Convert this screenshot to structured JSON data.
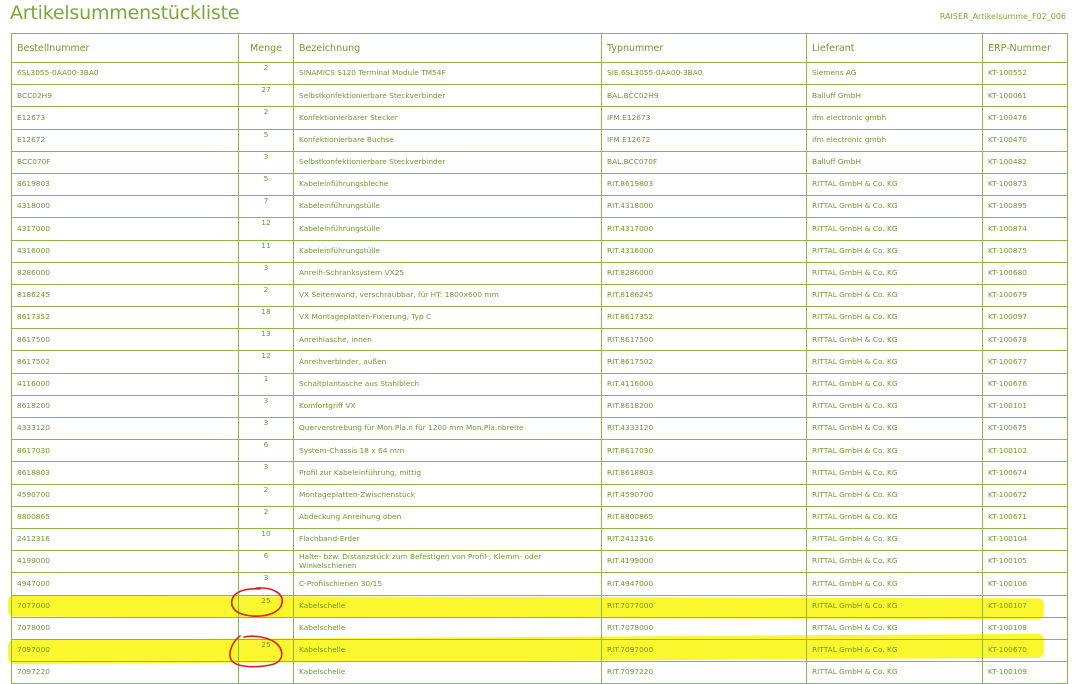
{
  "page": {
    "title": "Artikelsummenstückliste",
    "doc_id": "RAISER_Artikelsumme_F02_006"
  },
  "table": {
    "headers": [
      "Bestellnummer",
      "Menge",
      "Bezeichnung",
      "Typnummer",
      "Lieferant",
      "ERP-Nummer"
    ],
    "rows": [
      [
        "6SL3055-0AA00-3BA0",
        "2",
        "SINAMICS S120 Terminal Module TM54F",
        "SIE.6SL3055-0AA00-3BA0",
        "Siemens AG",
        "KT-100552"
      ],
      [
        "BCC02H9",
        "27",
        "Selbstkonfektionierbare Steckverbinder",
        "BAL.BCC02H9",
        "Balluff GmbH",
        "KT-100061"
      ],
      [
        "E12673",
        "2",
        "Konfektionierbarer Stecker",
        "IFM.E12673",
        "ifm electronic gmbh",
        "KT-100476"
      ],
      [
        "E12672",
        "5",
        "Konfektionierbare Buchse",
        "IFM.E12672",
        "ifm electronic gmbh",
        "KT-100470"
      ],
      [
        "BCC070F",
        "3",
        "Selbstkonfektionierbare Steckverbinder",
        "BAL.BCC070F",
        "Balluff GmbH",
        "KT-100482"
      ],
      [
        "8619803",
        "5",
        "Kabeleinführungsbleche",
        "RIT.8619803",
        "RITTAL GmbH & Co. KG",
        "KT-100873"
      ],
      [
        "4318000",
        "7",
        "Kabeleinführungstülle",
        "RIT.4318000",
        "RITTAL GmbH & Co. KG",
        "KT-100895"
      ],
      [
        "4317000",
        "12",
        "Kabeleinführungstülle",
        "RIT.4317000",
        "RITTAL GmbH & Co. KG",
        "KT-100874"
      ],
      [
        "4316000",
        "11",
        "Kabeleinführungstülle",
        "RIT.4316000",
        "RITTAL GmbH & Co. KG",
        "KT-100875"
      ],
      [
        "8286000",
        "3",
        "Anreih-Schranksystem VX25",
        "RIT.8286000",
        "RITTAL GmbH & Co. KG",
        "KT-100680"
      ],
      [
        "8186245",
        "2",
        "VX Seitenwand, verschraubbar, für HT: 1800x600 mm",
        "RIT.8186245",
        "RITTAL GmbH & Co. KG",
        "KT-100679"
      ],
      [
        "8617352",
        "18",
        "VX Montageplatten-Fixierung, Typ C",
        "RIT.8617352",
        "RITTAL GmbH & Co. KG",
        "KT-100097"
      ],
      [
        "8617500",
        "13",
        "Anreihlasche, innen",
        "RIT.8617500",
        "RITTAL GmbH & Co. KG",
        "KT-100678"
      ],
      [
        "8617502",
        "12",
        "Anreihverbinder, außen",
        "RIT.8617502",
        "RITTAL GmbH & Co. KG",
        "KT-100677"
      ],
      [
        "4116000",
        "1",
        "Schaltplantasche aus Stahlblech",
        "RIT.4116000",
        "RITTAL GmbH & Co. KG",
        "KT-100676"
      ],
      [
        "8618200",
        "3",
        "Komfortgriff VX",
        "RIT.8618200",
        "RITTAL GmbH & Co. KG",
        "KT-100101"
      ],
      [
        "4333120",
        "3",
        "Querverstrebung für Mon.Pla.n für 1200 mm Mon.Pla.nbreite",
        "RIT.4333120",
        "RITTAL GmbH & Co. KG",
        "KT-100675"
      ],
      [
        "8617030",
        "6",
        "System-Chassis 18 x 64 mm",
        "RIT.8617030",
        "RITTAL GmbH & Co. KG",
        "KT-100102"
      ],
      [
        "8618803",
        "3",
        "Profil zur Kabeleinführung, mittig",
        "RIT.8618803",
        "RITTAL GmbH & Co. KG",
        "KT-100674"
      ],
      [
        "4590700",
        "2",
        "Montageplatten-Zwischenstück",
        "RIT.4590700",
        "RITTAL GmbH & Co. KG",
        "KT-100672"
      ],
      [
        "8800865",
        "2",
        "Abdeckung Anreihung oben",
        "RIT.8800865",
        "RITTAL GmbH & Co. KG",
        "KT-100671"
      ],
      [
        "2412316",
        "10",
        "Flachband-Erder",
        "RIT.2412316",
        "RITTAL GmbH & Co. KG",
        "KT-100104"
      ],
      [
        "4199000",
        "6",
        "Halte- bzw. Distanzstück zum Befestigen von Profil-, Klemm- oder Winkelschienen",
        "RIT.4199000",
        "RITTAL GmbH & Co. KG",
        "KT-100105"
      ],
      [
        "4947000",
        "3",
        "C-Profilschienen 30/15",
        "RIT.4947000",
        "RITTAL GmbH & Co. KG",
        "KT-100106"
      ],
      [
        "7077000",
        "25",
        "Kabelschelle",
        "RIT.7077000",
        "RITTAL GmbH & Co. KG",
        "KT-100107"
      ],
      [
        "7078000",
        "",
        "Kabelschelle",
        "RIT.7078000",
        "RITTAL GmbH & Co. KG",
        "KT-100108"
      ],
      [
        "7097000",
        "25",
        "Kabelschelle",
        "RIT.7097000",
        "RITTAL GmbH & Co. KG",
        "KT-100670"
      ],
      [
        "7097220",
        "",
        "Kabelschelle",
        "RIT.7097220",
        "RITTAL GmbH & Co. KG",
        "KT-100109"
      ]
    ]
  },
  "annotations": {
    "highlight_color": "#fbf500",
    "circle_color": "#e0201c"
  }
}
